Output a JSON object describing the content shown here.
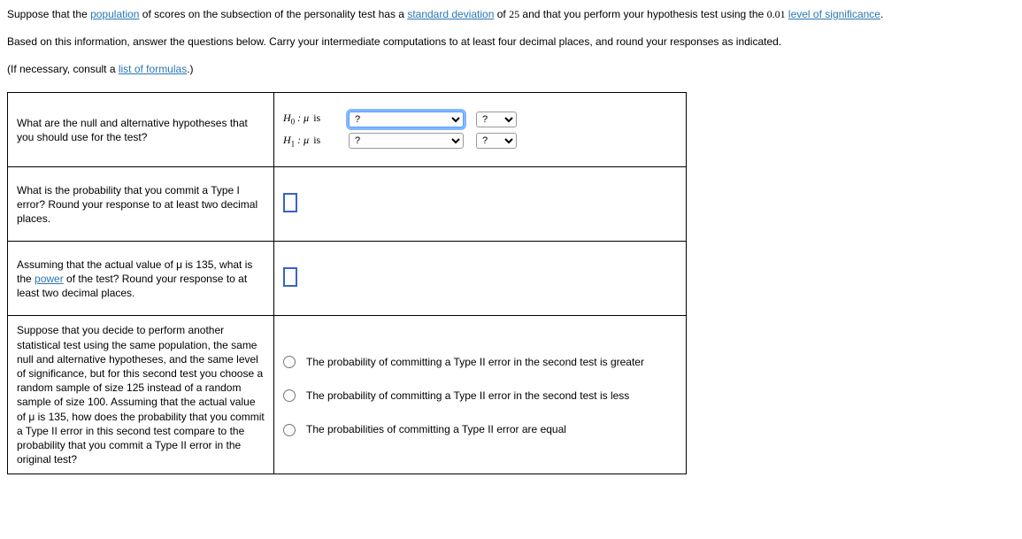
{
  "intro": {
    "line1a": "Suppose that the ",
    "link1": "population",
    "line1b": " of scores on the subsection of the personality test has a ",
    "link2": "standard deviation",
    "line1c": " of ",
    "num1": "25",
    "line1d": " and that you perform your hypothesis test using the ",
    "num2": "0.01",
    "space": " ",
    "link3": "level of significance",
    "dot": ".",
    "para2": "Based on this information, answer the questions below. Carry your intermediate computations to at least four decimal places, and round your responses as indicated.",
    "para3a": "(If necessary, consult a ",
    "link4": "list of formulas",
    "para3b": ".)"
  },
  "q1": {
    "text": "What are the null and alternative hypotheses that you should use for the test?",
    "h0_is": " is",
    "h1_is": " is"
  },
  "q2": {
    "text": "What is the probability that you commit a Type I error? Round your response to at least two decimal places."
  },
  "q3": {
    "text_a": "Assuming that the actual value of μ is 135, what is the ",
    "link": "power",
    "text_b": " of the test? Round your response to at least two decimal places."
  },
  "q4": {
    "text": "Suppose that you decide to perform another statistical test using the same population, the same null and alternative hypotheses, and the same level of significance, but for this second test you choose a random sample of size 125 instead of a random sample of size 100. Assuming that the actual value of μ is 135, how does the probability that you commit a Type II error in this second test compare to the probability that you commit a Type II error in the original test?",
    "opt1": "The probability of committing a Type II error in the second test is greater",
    "opt2": "The probability of committing a Type II error in the second test is less",
    "opt3": "The probabilities of committing a Type II error are equal"
  },
  "select": {
    "placeholder": "?"
  }
}
